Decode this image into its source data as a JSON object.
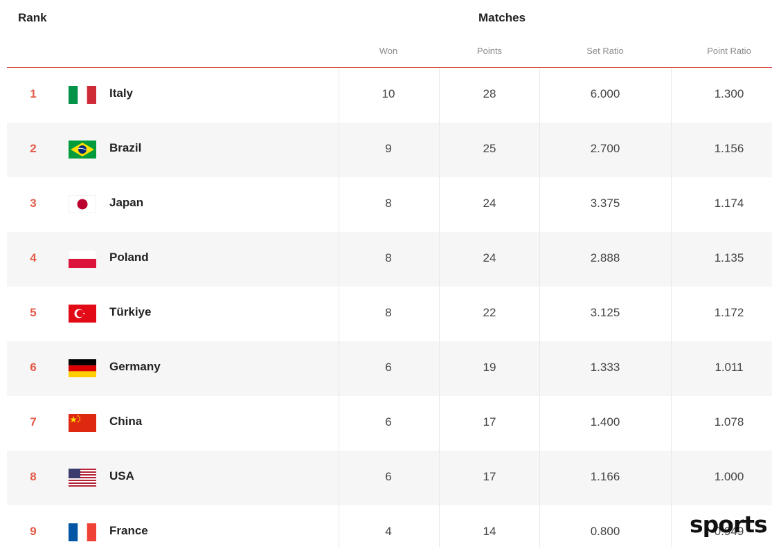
{
  "header": {
    "rank": "Rank",
    "matches": "Matches",
    "won": "Won",
    "points": "Points",
    "set_ratio": "Set Ratio",
    "point_ratio": "Point Ratio"
  },
  "rows": [
    {
      "rank": "1",
      "country": "Italy",
      "flag": "italy-flag",
      "won": "10",
      "points": "28",
      "set_ratio": "6.000",
      "point_ratio": "1.300"
    },
    {
      "rank": "2",
      "country": "Brazil",
      "flag": "brazil-flag",
      "won": "9",
      "points": "25",
      "set_ratio": "2.700",
      "point_ratio": "1.156"
    },
    {
      "rank": "3",
      "country": "Japan",
      "flag": "japan-flag",
      "won": "8",
      "points": "24",
      "set_ratio": "3.375",
      "point_ratio": "1.174"
    },
    {
      "rank": "4",
      "country": "Poland",
      "flag": "poland-flag",
      "won": "8",
      "points": "24",
      "set_ratio": "2.888",
      "point_ratio": "1.135"
    },
    {
      "rank": "5",
      "country": "Türkiye",
      "flag": "turkiye-flag",
      "won": "8",
      "points": "22",
      "set_ratio": "3.125",
      "point_ratio": "1.172"
    },
    {
      "rank": "6",
      "country": "Germany",
      "flag": "germany-flag",
      "won": "6",
      "points": "19",
      "set_ratio": "1.333",
      "point_ratio": "1.011"
    },
    {
      "rank": "7",
      "country": "China",
      "flag": "china-flag",
      "won": "6",
      "points": "17",
      "set_ratio": "1.400",
      "point_ratio": "1.078"
    },
    {
      "rank": "8",
      "country": "USA",
      "flag": "usa-flag",
      "won": "6",
      "points": "17",
      "set_ratio": "1.166",
      "point_ratio": "1.000"
    },
    {
      "rank": "9",
      "country": "France",
      "flag": "france-flag",
      "won": "4",
      "points": "14",
      "set_ratio": "0.800",
      "point_ratio": "0.949"
    }
  ],
  "watermark": "sports"
}
